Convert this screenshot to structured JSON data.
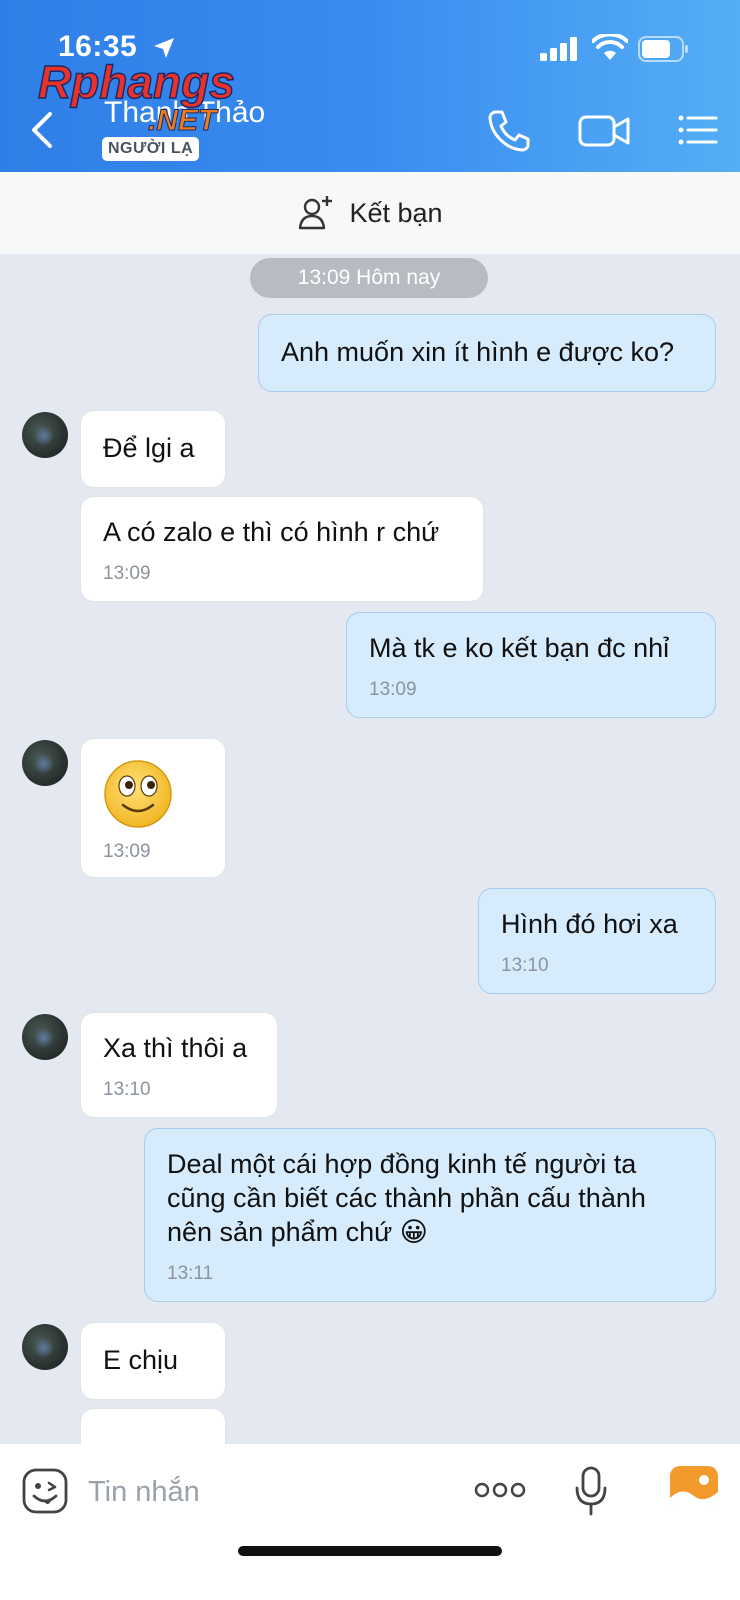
{
  "status_bar": {
    "time": "16:35"
  },
  "watermark": {
    "text_main": "Rphangs",
    "text_sub": ".NET"
  },
  "header": {
    "contact_name": "Thanh Thảo",
    "badge": "NGƯỜI LẠ"
  },
  "friend_bar": {
    "label": "Kết bạn"
  },
  "chat": {
    "time_pill": "13:09 Hôm nay",
    "messages": [
      {
        "dir": "out",
        "text": "Anh muốn xin ít hình e được ko?",
        "time": ""
      },
      {
        "dir": "in",
        "text": "Để lgi a",
        "time": ""
      },
      {
        "dir": "in",
        "text": "A có zalo e thì có hình r chứ",
        "time": "13:09"
      },
      {
        "dir": "out",
        "text": "Mà tk e ko kết bạn đc nhỉ",
        "time": "13:09"
      },
      {
        "dir": "in",
        "text": "🙂",
        "time": "13:09"
      },
      {
        "dir": "out",
        "text": "Hình đó hơi xa",
        "time": "13:10"
      },
      {
        "dir": "in",
        "text": "Xa thì thôi a",
        "time": "13:10"
      },
      {
        "dir": "out",
        "text": "Deal một cái hợp đồng kinh tế người ta cũng cần biết các thành phần cấu thành nên sản phẩm chứ 😀",
        "time": "13:11"
      },
      {
        "dir": "in",
        "text": "E chịu",
        "time": ""
      }
    ]
  },
  "input": {
    "placeholder": "Tin nhắn"
  },
  "colors": {
    "header_start": "#2f7fe6",
    "header_end": "#54aef5",
    "bubble_out": "#d6ecfd",
    "bubble_in": "#ffffff",
    "chat_bg": "#e4e8f0"
  }
}
